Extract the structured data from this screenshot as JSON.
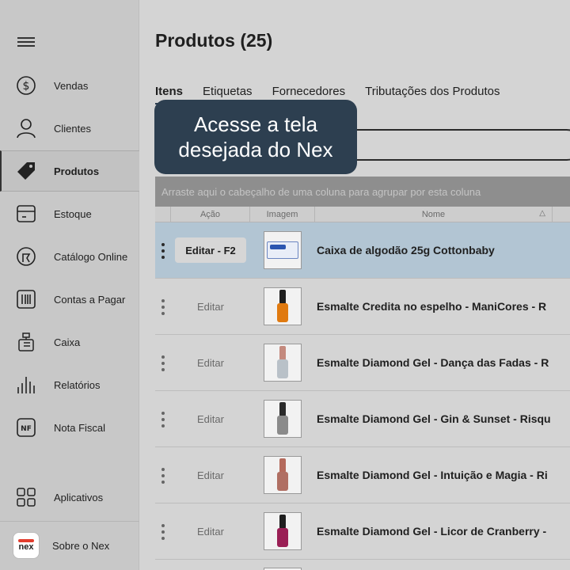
{
  "sidebar": {
    "menu_icon": "hamburger-menu-icon",
    "items": [
      {
        "label": "Vendas",
        "icon": "dollar-circle-icon"
      },
      {
        "label": "Clientes",
        "icon": "person-icon"
      },
      {
        "label": "Produtos",
        "icon": "tag-icon",
        "active": true
      },
      {
        "label": "Estoque",
        "icon": "box-icon"
      },
      {
        "label": "Catálogo Online",
        "icon": "catalog-icon"
      },
      {
        "label": "Contas a Pagar",
        "icon": "barcode-icon"
      },
      {
        "label": "Caixa",
        "icon": "cash-register-icon"
      },
      {
        "label": "Relatórios",
        "icon": "bar-chart-icon"
      },
      {
        "label": "Nota Fiscal",
        "icon": "nf-icon"
      }
    ],
    "apps_label": "Aplicativos",
    "about_label": "Sobre o Nex",
    "logo_text": "nex"
  },
  "main": {
    "title": "Produtos (25)",
    "tabs": [
      {
        "label": "Itens",
        "active": true
      },
      {
        "label": "Etiquetas"
      },
      {
        "label": "Fornecedores"
      },
      {
        "label": "Tributações dos Produtos"
      }
    ],
    "group_bar": "Arraste aqui o cabeçalho de uma coluna para agrupar por esta coluna",
    "columns": {
      "acao": "Ação",
      "imagem": "Imagem",
      "nome": "Nome",
      "sort_indicator": "△"
    },
    "rows": [
      {
        "edit": "Editar - F2",
        "name": "Caixa de algodão 25g Cottonbaby",
        "selected": true,
        "image": "cotton-box"
      },
      {
        "edit": "Editar",
        "name": "Esmalte Credita no espelho - ManiCores - R",
        "image": "bottle",
        "cap": "#1f1f1f",
        "body": "#e07a10"
      },
      {
        "edit": "Editar",
        "name": "Esmalte Diamond Gel - Dança das Fadas - R",
        "image": "bottle",
        "cap": "#c48a7e",
        "body": "#b9c1c8"
      },
      {
        "edit": "Editar",
        "name": "Esmalte Diamond Gel - Gin & Sunset - Risqu",
        "image": "bottle",
        "cap": "#2a2a2a",
        "body": "#8a8a8a"
      },
      {
        "edit": "Editar",
        "name": "Esmalte Diamond Gel - Intuição e Magia - Ri",
        "image": "bottle",
        "cap": "#b46a5c",
        "body": "#b06f63"
      },
      {
        "edit": "Editar",
        "name": "Esmalte Diamond Gel - Licor de Cranberry -",
        "image": "bottle",
        "cap": "#1f1f1f",
        "body": "#9a1f55"
      }
    ]
  },
  "tooltip": {
    "text": "Acesse a tela desejada do Nex"
  }
}
